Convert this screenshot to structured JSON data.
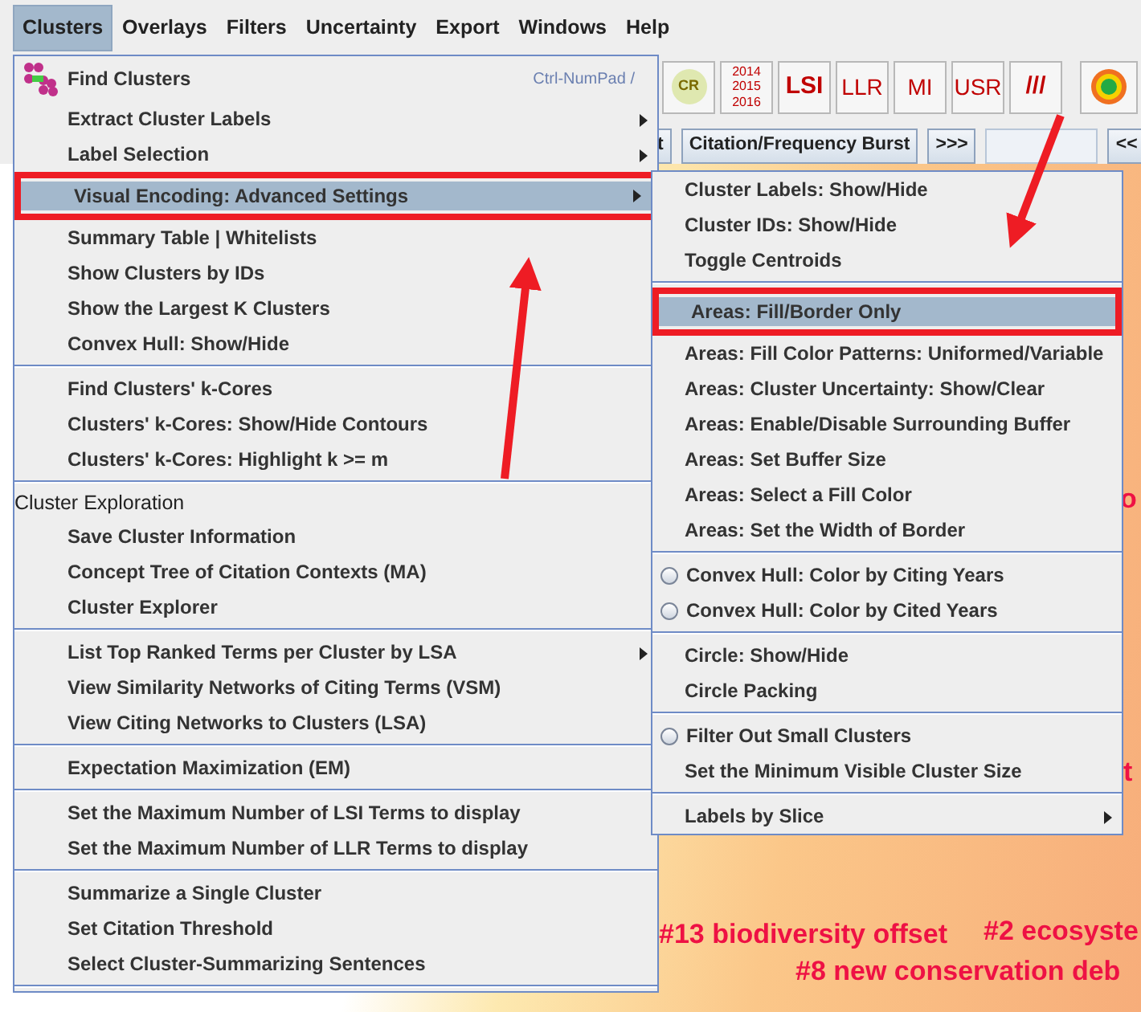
{
  "menubar": [
    {
      "label": "Clusters",
      "selected": true
    },
    {
      "label": "Overlays",
      "selected": false
    },
    {
      "label": "Filters",
      "selected": false
    },
    {
      "label": "Uncertainty",
      "selected": false
    },
    {
      "label": "Export",
      "selected": false
    },
    {
      "label": "Windows",
      "selected": false
    },
    {
      "label": "Help",
      "selected": false
    }
  ],
  "toolbar": [
    {
      "kind": "circle",
      "label": "CR"
    },
    {
      "kind": "years",
      "lines": [
        "2014",
        "2015",
        "2016"
      ]
    },
    {
      "kind": "text",
      "label": "LSI",
      "bold": true
    },
    {
      "kind": "text",
      "label": "LLR",
      "bold": false
    },
    {
      "kind": "text",
      "label": "MI",
      "bold": false
    },
    {
      "kind": "text",
      "label": "USR",
      "bold": false
    },
    {
      "kind": "text",
      "label": "///",
      "bold": true
    },
    {
      "kind": "target"
    }
  ],
  "toolbar_2": [
    {
      "kind": "button",
      "label": "t"
    },
    {
      "kind": "button",
      "label": "Citation/Frequency Burst"
    },
    {
      "kind": "button",
      "label": ">>>"
    },
    {
      "kind": "field"
    },
    {
      "kind": "button",
      "label": "<<"
    }
  ],
  "canvas_labels": [
    {
      "text": "o"
    },
    {
      "text": "t"
    },
    {
      "text": "#13 biodiversity offset"
    },
    {
      "text": "#2 ecosyste"
    },
    {
      "text": "#8 new conservation deb"
    }
  ],
  "menu": [
    {
      "kind": "icon",
      "label": "Find Clusters",
      "shortcut": "Ctrl-NumPad /",
      "selected": false
    },
    {
      "kind": "item",
      "label": "Extract Cluster Labels",
      "submenu": true,
      "selected": false
    },
    {
      "kind": "item",
      "label": "Label Selection",
      "submenu": true,
      "selected": false
    },
    {
      "kind": "item",
      "label": "Visual Encoding: Advanced Settings",
      "submenu": true,
      "selected": true
    },
    {
      "kind": "item",
      "label": "Summary Table | Whitelists",
      "submenu": false,
      "selected": false
    },
    {
      "kind": "item",
      "label": "Show Clusters by IDs",
      "submenu": false,
      "selected": false
    },
    {
      "kind": "item",
      "label": "Show the Largest K Clusters",
      "submenu": false,
      "selected": false
    },
    {
      "kind": "item",
      "label": "Convex Hull: Show/Hide",
      "submenu": false,
      "selected": false
    },
    {
      "kind": "separator"
    },
    {
      "kind": "item",
      "label": "Find Clusters' k-Cores",
      "submenu": false,
      "selected": false
    },
    {
      "kind": "item",
      "label": "Clusters' k-Cores: Show/Hide Contours",
      "submenu": false,
      "selected": false
    },
    {
      "kind": "item",
      "label": "Clusters' k-Cores: Highlight k >= m",
      "submenu": false,
      "selected": false
    },
    {
      "kind": "separator"
    },
    {
      "kind": "header",
      "label": "Cluster Exploration"
    },
    {
      "kind": "item",
      "label": "Save Cluster Information",
      "submenu": false,
      "selected": false
    },
    {
      "kind": "item",
      "label": "Concept Tree of Citation Contexts (MA)",
      "submenu": false,
      "selected": false
    },
    {
      "kind": "item",
      "label": "Cluster Explorer",
      "submenu": false,
      "selected": false
    },
    {
      "kind": "separator"
    },
    {
      "kind": "item",
      "label": "List Top Ranked Terms per Cluster by LSA",
      "submenu": true,
      "selected": false
    },
    {
      "kind": "item",
      "label": "View Similarity Networks of Citing Terms (VSM)",
      "submenu": false,
      "selected": false
    },
    {
      "kind": "item",
      "label": "View Citing Networks to Clusters (LSA)",
      "submenu": false,
      "selected": false
    },
    {
      "kind": "separator"
    },
    {
      "kind": "item",
      "label": "Expectation Maximization (EM)",
      "submenu": false,
      "selected": false
    },
    {
      "kind": "separator"
    },
    {
      "kind": "item",
      "label": "Set the Maximum Number of LSI Terms to display",
      "submenu": false,
      "selected": false
    },
    {
      "kind": "item",
      "label": "Set the Maximum Number of LLR Terms to display",
      "submenu": false,
      "selected": false
    },
    {
      "kind": "separator"
    },
    {
      "kind": "item",
      "label": "Summarize a Single Cluster",
      "submenu": false,
      "selected": false
    },
    {
      "kind": "item",
      "label": "Set Citation Threshold",
      "submenu": false,
      "selected": false
    },
    {
      "kind": "item",
      "label": "Select Cluster-Summarizing Sentences",
      "submenu": false,
      "selected": false
    },
    {
      "kind": "separator"
    }
  ],
  "submenu": [
    {
      "kind": "item",
      "label": "Cluster Labels: Show/Hide",
      "submenu": false,
      "selected": false
    },
    {
      "kind": "item",
      "label": "Cluster IDs: Show/Hide",
      "submenu": false,
      "selected": false
    },
    {
      "kind": "item",
      "label": "Toggle Centroids",
      "submenu": false,
      "selected": false
    },
    {
      "kind": "separator"
    },
    {
      "kind": "item",
      "label": "Areas: Fill/Border Only",
      "submenu": false,
      "selected": true
    },
    {
      "kind": "item",
      "label": "Areas: Fill Color Patterns: Uniformed/Variable",
      "submenu": false,
      "selected": false
    },
    {
      "kind": "item",
      "label": "Areas: Cluster Uncertainty: Show/Clear",
      "submenu": false,
      "selected": false
    },
    {
      "kind": "item",
      "label": "Areas: Enable/Disable Surrounding Buffer",
      "submenu": false,
      "selected": false
    },
    {
      "kind": "item",
      "label": "Areas: Set Buffer Size",
      "submenu": false,
      "selected": false
    },
    {
      "kind": "item",
      "label": "Areas: Select a Fill Color",
      "submenu": false,
      "selected": false
    },
    {
      "kind": "item",
      "label": "Areas: Set the Width of Border",
      "submenu": false,
      "selected": false
    },
    {
      "kind": "separator"
    },
    {
      "kind": "radio",
      "label": "Convex Hull: Color by Citing Years",
      "checked": false,
      "selected": false
    },
    {
      "kind": "radio",
      "label": "Convex Hull: Color by Cited Years",
      "checked": false,
      "selected": false
    },
    {
      "kind": "separator"
    },
    {
      "kind": "item",
      "label": "Circle: Show/Hide",
      "submenu": false,
      "selected": false
    },
    {
      "kind": "item",
      "label": "Circle Packing",
      "submenu": false,
      "selected": false
    },
    {
      "kind": "separator"
    },
    {
      "kind": "radio",
      "label": "Filter Out Small Clusters",
      "checked": false,
      "selected": false
    },
    {
      "kind": "item",
      "label": "Set the Minimum Visible Cluster Size",
      "submenu": false,
      "selected": false
    },
    {
      "kind": "separator"
    },
    {
      "kind": "item",
      "label": "Labels by Slice",
      "submenu": true,
      "selected": false
    }
  ]
}
